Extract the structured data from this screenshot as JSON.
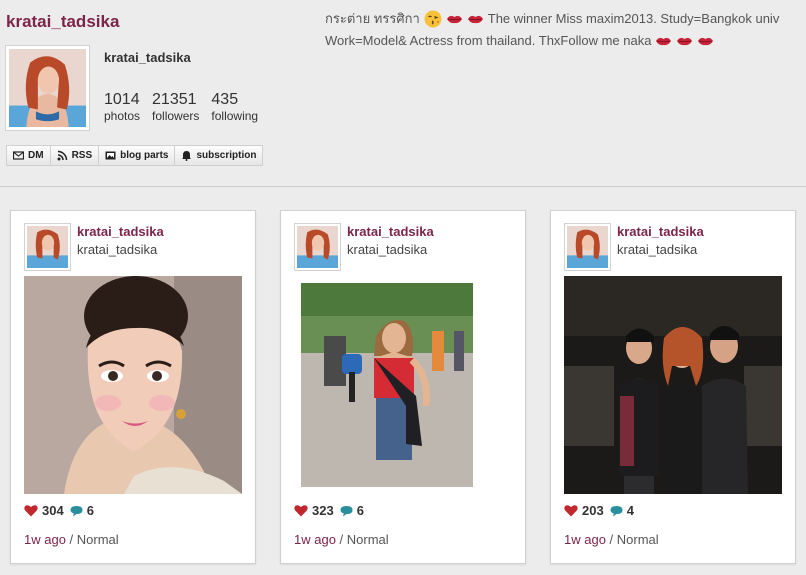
{
  "profile": {
    "display_name": "kratai_tadsika",
    "username": "kratai_tadsika",
    "stats": [
      {
        "count": "1014",
        "label": "photos"
      },
      {
        "count": "21351",
        "label": "followers"
      },
      {
        "count": "435",
        "label": "following"
      }
    ],
    "buttons": [
      {
        "label": "DM",
        "icon": "mail-icon"
      },
      {
        "label": "RSS",
        "icon": "rss-icon"
      },
      {
        "label": "blog parts",
        "icon": "photo-icon"
      },
      {
        "label": "subscription",
        "icon": "bell-icon"
      }
    ],
    "bio": {
      "line1_a": "กระต่าย ทรรศิกา",
      "line1_b": "The winner Miss maxim2013. Study=Bangkok univ",
      "line2": "Work=Model& Actress from thailand. ThxFollow me naka"
    }
  },
  "posts": [
    {
      "name": "kratai_tadsika",
      "username": "kratai_tadsika",
      "likes": "304",
      "comments": "6",
      "time": "1w ago",
      "filter": "Normal"
    },
    {
      "name": "kratai_tadsika",
      "username": "kratai_tadsika",
      "likes": "323",
      "comments": "6",
      "time": "1w ago",
      "filter": "Normal"
    },
    {
      "name": "kratai_tadsika",
      "username": "kratai_tadsika",
      "likes": "203",
      "comments": "4",
      "time": "1w ago",
      "filter": "Normal"
    }
  ],
  "colors": {
    "accent": "#7d2449",
    "heart": "#c0282d",
    "comment": "#2a8f9c",
    "background": "#ececec"
  }
}
